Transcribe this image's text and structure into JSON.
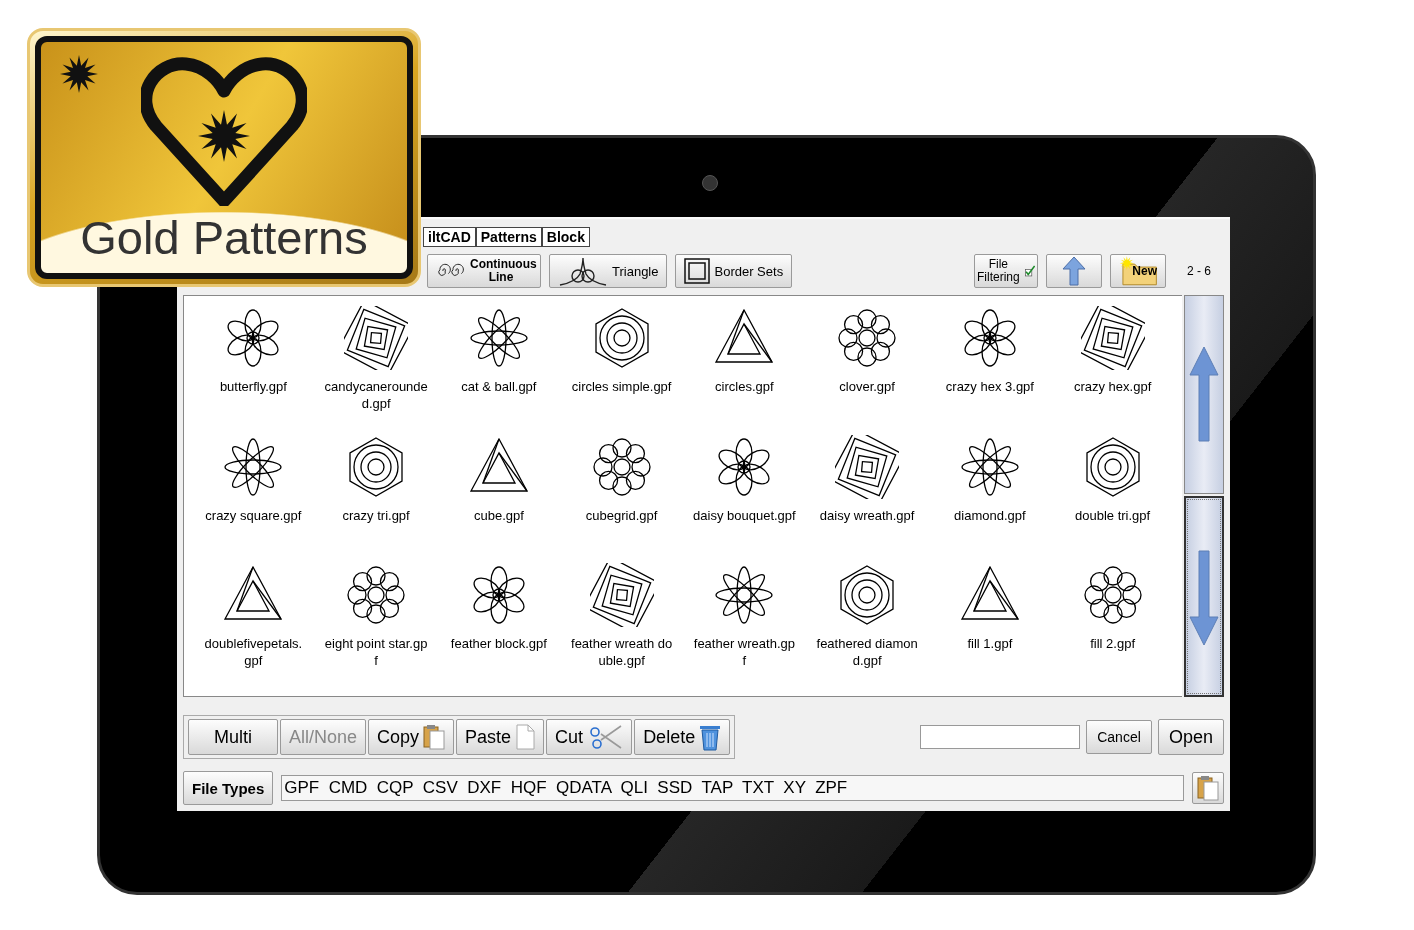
{
  "badge": {
    "title": "Gold Patterns"
  },
  "tabs": [
    {
      "label": "iltCAD"
    },
    {
      "label": "Patterns"
    },
    {
      "label": "Block"
    }
  ],
  "toolbar": [
    {
      "kind": "continuous",
      "label": "Continuous Line"
    },
    {
      "kind": "triangle",
      "label": "Triangle"
    },
    {
      "kind": "border",
      "label": "Border Sets"
    }
  ],
  "toolbar_right": [
    {
      "kind": "filter",
      "label": "File Filtering"
    },
    {
      "kind": "up"
    },
    {
      "kind": "new",
      "label": "New"
    }
  ],
  "page_indicator": "2 - 6",
  "files": [
    {
      "name": "butterfly.gpf"
    },
    {
      "name": "candycanerounded.gpf"
    },
    {
      "name": "cat & ball.gpf"
    },
    {
      "name": "circles simple.gpf"
    },
    {
      "name": "circles.gpf"
    },
    {
      "name": "clover.gpf"
    },
    {
      "name": "crazy hex 3.gpf"
    },
    {
      "name": "crazy hex.gpf"
    },
    {
      "name": "crazy square.gpf"
    },
    {
      "name": "crazy tri.gpf"
    },
    {
      "name": "cube.gpf"
    },
    {
      "name": "cubegrid.gpf"
    },
    {
      "name": "daisy bouquet.gpf"
    },
    {
      "name": "daisy wreath.gpf"
    },
    {
      "name": "diamond.gpf"
    },
    {
      "name": "double tri.gpf"
    },
    {
      "name": "doublefivepetals.gpf"
    },
    {
      "name": "eight point star.gpf"
    },
    {
      "name": "feather block.gpf"
    },
    {
      "name": "feather wreath double.gpf"
    },
    {
      "name": "feather wreath.gpf"
    },
    {
      "name": "feathered diamond.gpf"
    },
    {
      "name": "fill 1.gpf"
    },
    {
      "name": "fill 2.gpf"
    }
  ],
  "actions": [
    {
      "kind": "plain",
      "label": "Multi",
      "disabled": false
    },
    {
      "kind": "plain",
      "label": "All/None",
      "disabled": true
    },
    {
      "kind": "copy",
      "label": "Copy",
      "disabled": false
    },
    {
      "kind": "paste",
      "label": "Paste",
      "disabled": false
    },
    {
      "kind": "cut",
      "label": "Cut",
      "disabled": false
    },
    {
      "kind": "delete",
      "label": "Delete",
      "disabled": false
    }
  ],
  "dialog_buttons": [
    {
      "label": "Cancel"
    },
    {
      "label": "Open"
    }
  ],
  "file_types": {
    "button": "File Types",
    "value": "GPF  CMD  CQP  CSV  DXF  HQF  QDATA  QLI  SSD  TAP  TXT  XY  ZPF"
  }
}
